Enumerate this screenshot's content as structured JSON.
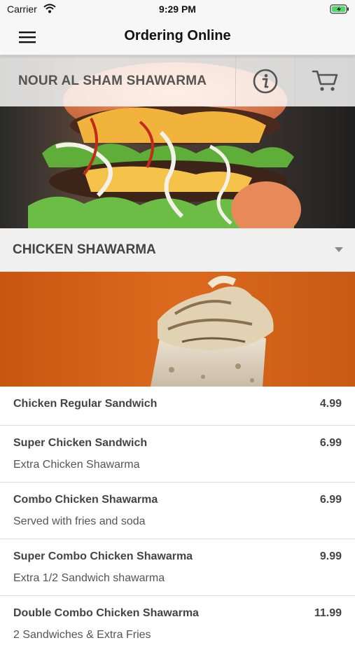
{
  "status_bar": {
    "carrier": "Carrier",
    "time": "9:29 PM"
  },
  "nav": {
    "title": "Ordering Online",
    "menu_icon": "hamburger-menu-icon"
  },
  "restaurant": {
    "name": "NOUR AL SHAM SHAWARMA",
    "info_icon": "info-icon",
    "cart_icon": "cart-icon"
  },
  "category": {
    "title": "CHICKEN SHAWARMA",
    "chevron_icon": "chevron-down-icon"
  },
  "items": [
    {
      "name": "Chicken Regular Sandwich",
      "price": "4.99",
      "description": ""
    },
    {
      "name": "Super Chicken Sandwich",
      "price": "6.99",
      "description": "Extra Chicken Shawarma"
    },
    {
      "name": "Combo Chicken Shawarma",
      "price": "6.99",
      "description": "Served with fries and soda"
    },
    {
      "name": "Super Combo Chicken Shawarma",
      "price": "9.99",
      "description": "Extra 1/2 Sandwich shawarma"
    },
    {
      "name": "Double Combo Chicken Shawarma",
      "price": "11.99",
      "description": "2 Sandwiches & Extra Fries"
    }
  ],
  "colors": {
    "accent_orange": "#d8621c",
    "header_bg": "#f7f7f7",
    "category_bg": "#f0f0f0"
  }
}
